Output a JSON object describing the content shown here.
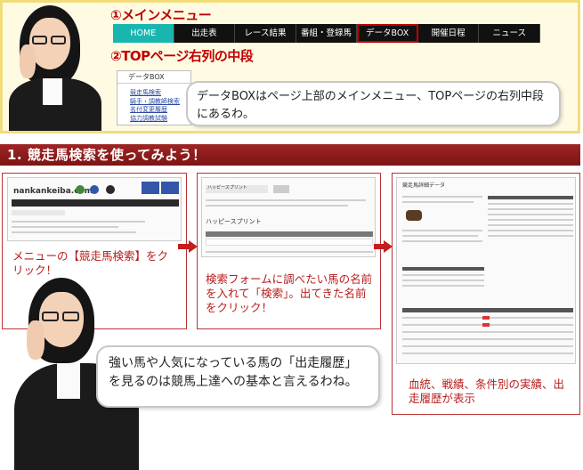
{
  "guide": {
    "label_main_menu": "①メインメニュー",
    "label_top_page": "②TOPページ右列の中段",
    "nav_items": [
      "HOME",
      "出走表",
      "レース結果",
      "番組・登録馬",
      "データBOX",
      "開催日程",
      "ニュース"
    ],
    "databox_title": "データBOX",
    "databox_items": [
      "競走馬検索",
      "騎手・調教師検索",
      "名付変更履歴",
      "協力調教試験"
    ],
    "bubble_text": "データBOXはページ上部のメインメニュー、TOPページの右列中段にあるわ。"
  },
  "section": {
    "title": "1. 競走馬検索を使ってみよう！"
  },
  "steps": [
    {
      "caption": "メニューの【競走馬検索】をクリック！",
      "site_logo": "nankankeiba.com"
    },
    {
      "caption": "検索フォームに調べたい馬の名前を入れて「検索」。出てきた名前をクリック！",
      "search_name": "ハッピースプリント",
      "search_button": "検索"
    },
    {
      "caption": "血統、戦績、条件別の実績、出走履歴が表示",
      "page_title": "競走馬詳細データ"
    }
  ],
  "bottom_bubble": "強い馬や人気になっている馬の「出走履歴」を見るのは競馬上達への基本と言えるわね。",
  "colors": {
    "accent_red": "#c00000",
    "home_teal": "#19b6b0",
    "frame_yellow": "#f2dc7a"
  }
}
